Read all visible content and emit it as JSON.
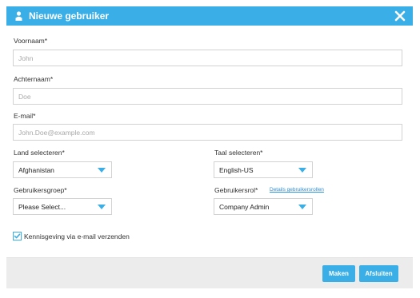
{
  "dialog": {
    "title": "Nieuwe gebruiker",
    "icons": {
      "title": "user-icon",
      "close": "close-icon"
    },
    "accent_color": "#3aaee6"
  },
  "form": {
    "first_name": {
      "label": "Voornaam*",
      "placeholder": "John"
    },
    "last_name": {
      "label": "Achternaam*",
      "placeholder": "Doe"
    },
    "email": {
      "label": "E-mail*",
      "placeholder": "John.Doe@example.com"
    },
    "country": {
      "label": "Land selecteren*",
      "value": "Afghanistan"
    },
    "language": {
      "label": "Taal selecteren*",
      "value": "English-US"
    },
    "user_group": {
      "label": "Gebruikersgroep*",
      "value": "Please Select..."
    },
    "user_role": {
      "label": "Gebruikersrol*",
      "value": "Company Admin",
      "details_link": "Details gebruikersrollen"
    },
    "notify": {
      "label": "Kennisgeving via e-mail verzenden",
      "checked": true
    }
  },
  "footer": {
    "create_label": "Maken",
    "close_label": "Afsluiten"
  }
}
